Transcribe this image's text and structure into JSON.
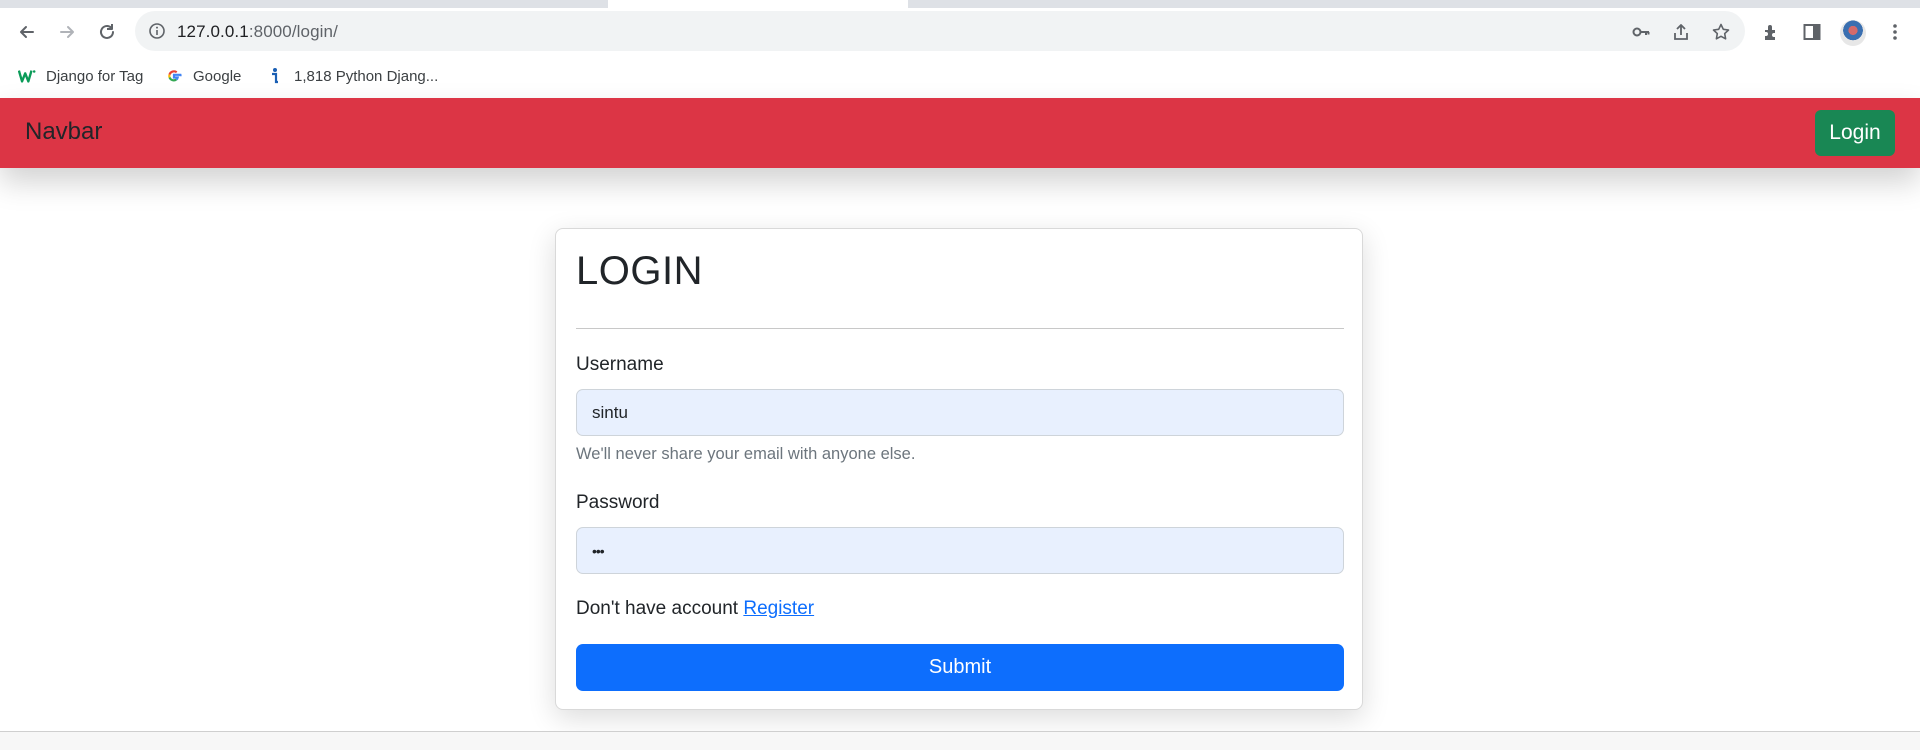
{
  "browser": {
    "url_host": "127.0.0.1",
    "url_path": ":8000/login/",
    "bookmarks": [
      {
        "label": "Django for Tag",
        "icon": "w-logo-icon"
      },
      {
        "label": "Google",
        "icon": "google-g-icon"
      },
      {
        "label": "1,818 Python Djang...",
        "icon": "info-i-icon"
      }
    ]
  },
  "navbar": {
    "brand": "Navbar",
    "login_label": "Login",
    "color": "#dc3545"
  },
  "form": {
    "title": "LOGIN",
    "username_label": "Username",
    "username_value": "sintu",
    "username_help": "We'll never share your email with anyone else.",
    "password_label": "Password",
    "password_value": "•••",
    "register_prompt": "Don't have account",
    "register_link": "Register",
    "submit_label": "Submit"
  },
  "colors": {
    "submit": "#0d6efd",
    "login_button": "#198754",
    "autofill": "#e8f0fe"
  }
}
